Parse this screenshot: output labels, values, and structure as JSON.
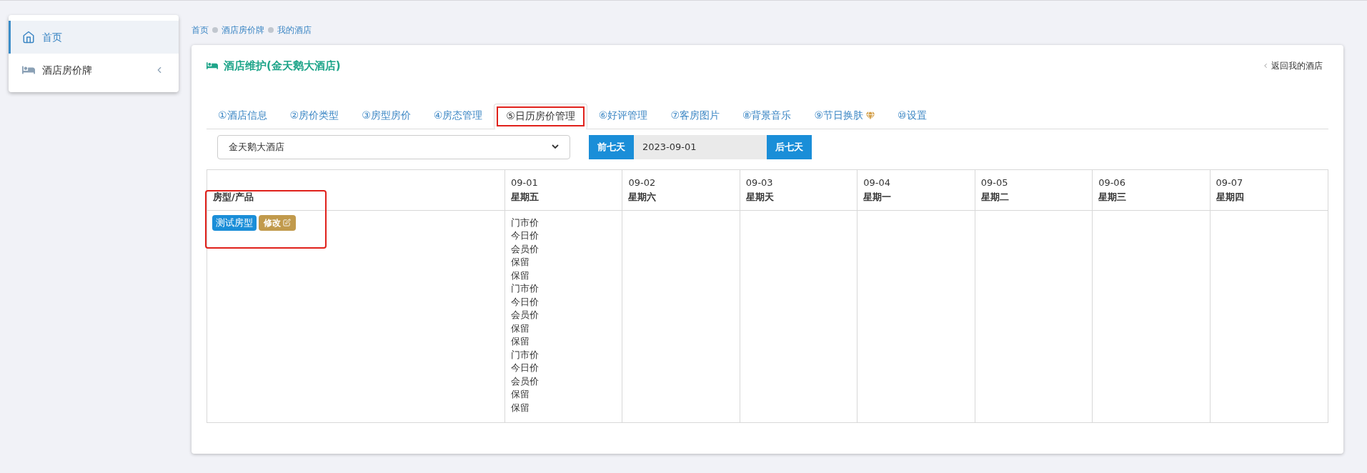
{
  "sidebar": {
    "items": [
      {
        "label": "首页",
        "kind": "home",
        "selected": true,
        "expandable": false
      },
      {
        "label": "酒店房价牌",
        "kind": "bed",
        "selected": false,
        "expandable": true
      }
    ]
  },
  "breadcrumb": [
    "首页",
    "酒店房价牌",
    "我的酒店"
  ],
  "panel": {
    "title": "酒店维护(金天鹅大酒店)",
    "back_link": "返回我的酒店"
  },
  "tabs": [
    {
      "label": "①酒店信息",
      "selected": false,
      "highlighted": false,
      "premium": false
    },
    {
      "label": "②房价类型",
      "selected": false,
      "highlighted": false,
      "premium": false
    },
    {
      "label": "③房型房价",
      "selected": false,
      "highlighted": false,
      "premium": false
    },
    {
      "label": "④房态管理",
      "selected": false,
      "highlighted": false,
      "premium": false
    },
    {
      "label": "⑤日历房价管理",
      "selected": true,
      "highlighted": true,
      "premium": false
    },
    {
      "label": "⑥好评管理",
      "selected": false,
      "highlighted": false,
      "premium": false
    },
    {
      "label": "⑦客房图片",
      "selected": false,
      "highlighted": false,
      "premium": false
    },
    {
      "label": "⑧背景音乐",
      "selected": false,
      "highlighted": false,
      "premium": false
    },
    {
      "label": "⑨节日换肤",
      "selected": false,
      "highlighted": false,
      "premium": true
    },
    {
      "label": "⑩设置",
      "selected": false,
      "highlighted": false,
      "premium": false
    }
  ],
  "hotel_select": {
    "value": "金天鹅大酒店"
  },
  "date_nav": {
    "prev": "前七天",
    "date": "2023-09-01",
    "next": "后七天"
  },
  "table": {
    "corner": "房型/产品",
    "columns": [
      {
        "date": "09-01",
        "weekday": "星期五"
      },
      {
        "date": "09-02",
        "weekday": "星期六"
      },
      {
        "date": "09-03",
        "weekday": "星期天"
      },
      {
        "date": "09-04",
        "weekday": "星期一"
      },
      {
        "date": "09-05",
        "weekday": "星期二"
      },
      {
        "date": "09-06",
        "weekday": "星期三"
      },
      {
        "date": "09-07",
        "weekday": "星期四"
      }
    ],
    "rows": [
      {
        "room_type": "测试房型",
        "edit_button": "修改",
        "highlighted": true,
        "day_cells": [
          {
            "lines": [
              "门市价",
              "今日价",
              "会员价",
              "保留",
              "保留",
              "门市价",
              "今日价",
              "会员价",
              "保留",
              "保留",
              "门市价",
              "今日价",
              "会员价",
              "保留",
              "保留"
            ]
          }
        ]
      }
    ]
  }
}
